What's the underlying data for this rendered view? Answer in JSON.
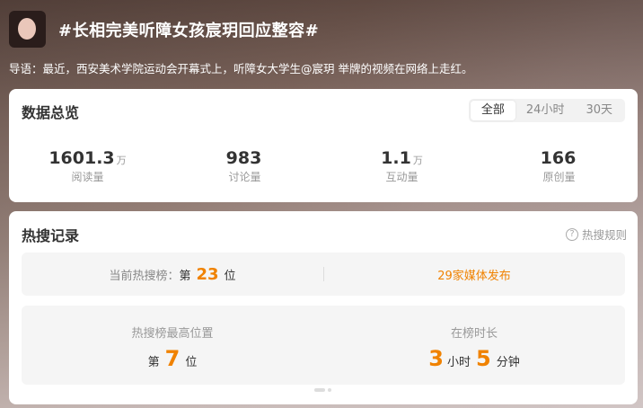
{
  "header": {
    "title": "#长相完美听障女孩宸玥回应整容#"
  },
  "guide": "导语：最近，西安美术学院运动会开幕式上，听障女大学生@宸玥 举牌的视频在网络上走红。",
  "overview": {
    "title": "数据总览",
    "tabs": [
      "全部",
      "24小时",
      "30天"
    ],
    "stats": [
      {
        "value": "1601.3",
        "unit": "万",
        "label": "阅读量"
      },
      {
        "value": "983",
        "unit": "",
        "label": "讨论量"
      },
      {
        "value": "1.1",
        "unit": "万",
        "label": "互动量"
      },
      {
        "value": "166",
        "unit": "",
        "label": "原创量"
      }
    ]
  },
  "hot": {
    "title": "热搜记录",
    "rules": "热搜规则",
    "rules_icon": "?",
    "current_prefix": "当前热搜榜：",
    "current_di": "第",
    "current_rank": "23",
    "current_wei": "位",
    "media": "29家媒体发布",
    "peak_label": "热搜榜最高位置",
    "peak_di": "第",
    "peak_rank": "7",
    "peak_wei": "位",
    "duration_label": "在榜时长",
    "duration_hours": "3",
    "duration_hours_unit": "小时",
    "duration_minutes": "5",
    "duration_minutes_unit": "分钟"
  }
}
